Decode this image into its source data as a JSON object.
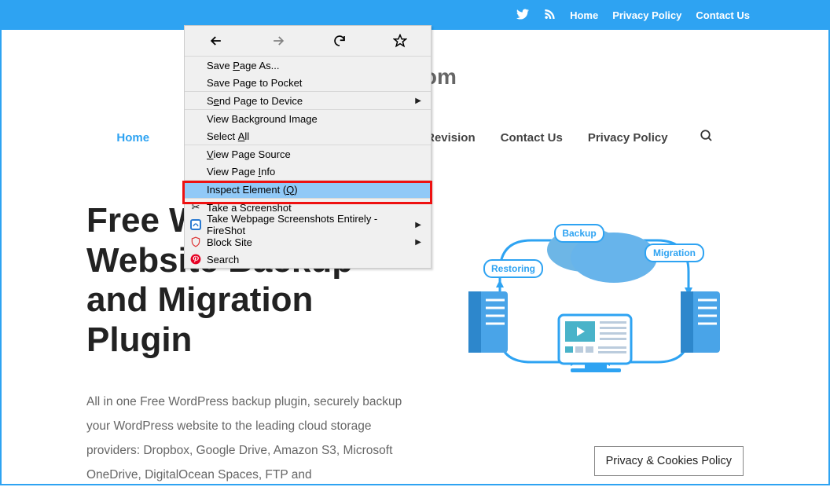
{
  "topbar": {
    "links": [
      "Home",
      "Privacy Policy",
      "Contact Us"
    ]
  },
  "site_title_suffix": "vid.com",
  "main_nav": {
    "items": [
      "Home",
      "Revision",
      "Contact Us",
      "Privacy Policy"
    ],
    "active_index": 0
  },
  "hero": {
    "heading": "Free WordPress Website Backup and Migration Plugin",
    "paragraph": "All in one Free WordPress backup plugin, securely backup your WordPress website to the leading cloud storage providers: Dropbox, Google Drive, Amazon S3, Microsoft OneDrive, DigitalOcean Spaces, FTP and"
  },
  "illustration_labels": {
    "restoring": "Restoring",
    "backup": "Backup",
    "migration": "Migration"
  },
  "cookies": "Privacy & Cookies Policy",
  "context_menu": {
    "save_page_as": "Save Page As...",
    "save_to_pocket": "Save Page to Pocket",
    "send_to_device": "Send Page to Device",
    "view_bg_image": "View Background Image",
    "select_all": "Select All",
    "view_source": "View Page Source",
    "view_info": "View Page Info",
    "inspect_element": "Inspect Element (Q)",
    "take_screenshot": "Take a Screenshot",
    "fireshot": "Take Webpage Screenshots Entirely - FireShot",
    "block_site": "Block Site",
    "search_label": "Search"
  }
}
